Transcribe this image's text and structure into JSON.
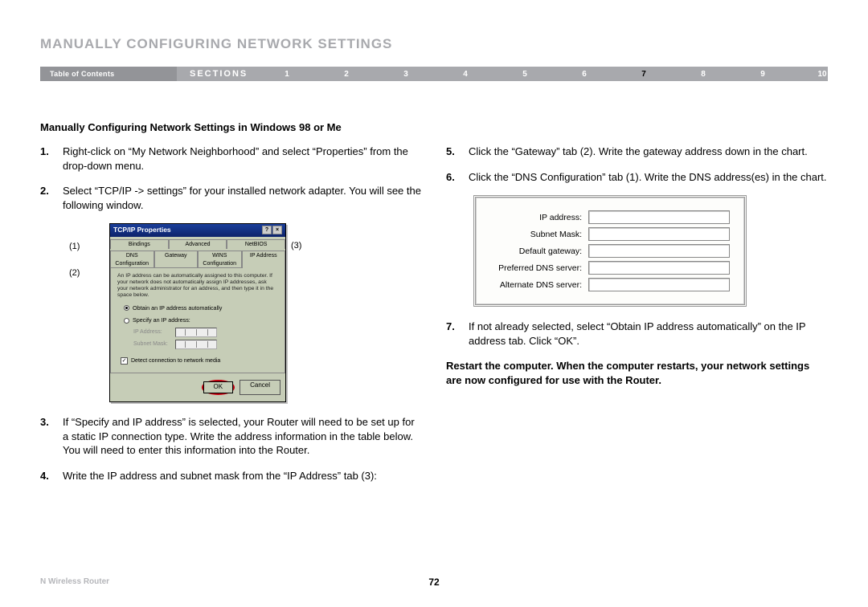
{
  "title": "MANUALLY CONFIGURING NETWORK SETTINGS",
  "nav": {
    "toc": "Table of Contents",
    "sections": "SECTIONS",
    "numbers": [
      "1",
      "2",
      "3",
      "4",
      "5",
      "6",
      "7",
      "8",
      "9",
      "10"
    ],
    "active": "7"
  },
  "subheading": "Manually Configuring Network Settings in Windows 98 or Me",
  "left_steps": [
    {
      "n": "1.",
      "t": "Right-click on “My Network Neighborhood” and select “Properties” from the drop-down menu."
    },
    {
      "n": "2.",
      "t": "Select “TCP/IP -> settings” for your installed network adapter. You will see the following window."
    },
    {
      "n": "3.",
      "t": "If “Specify and IP address” is selected, your Router will need to be set up for a static IP connection type. Write the address information in the table below. You will need to enter this information into the Router."
    },
    {
      "n": "4.",
      "t": "Write the IP address and subnet mask from the “IP Address” tab (3):"
    }
  ],
  "right_steps": [
    {
      "n": "5.",
      "t": "Click the “Gateway” tab (2). Write the gateway address down in the chart."
    },
    {
      "n": "6.",
      "t": "Click the “DNS Configuration” tab (1). Write the DNS address(es) in the chart."
    },
    {
      "n": "7.",
      "t": "If not already selected, select “Obtain IP address automatically” on the IP address tab. Click “OK”."
    }
  ],
  "restart_note": "Restart the computer. When the computer restarts, your network settings are now configured for use with the Router.",
  "callouts": {
    "c1": "(1)",
    "c2": "(2)",
    "c3": "(3)"
  },
  "tcpip": {
    "title": "TCP/IP Properties",
    "row1": [
      "Bindings",
      "Advanced",
      "NetBIOS"
    ],
    "row2": [
      "DNS Configuration",
      "Gateway",
      "WINS Configuration",
      "IP Address"
    ],
    "desc": "An IP address can be automatically assigned to this computer. If your network does not automatically assign IP addresses, ask your network administrator for an address, and then type it in the space below.",
    "radio1": "Obtain an IP address automatically",
    "radio2": "Specify an IP address:",
    "ip_label": "IP Address:",
    "mask_label": "Subnet Mask:",
    "detect": "Detect connection to network media",
    "ok": "OK",
    "cancel": "Cancel"
  },
  "iptable": {
    "rows": [
      "IP address:",
      "Subnet Mask:",
      "Default gateway:",
      "Preferred DNS server:",
      "Alternate DNS server:"
    ]
  },
  "footer": {
    "product": "N Wireless Router",
    "page": "72"
  }
}
